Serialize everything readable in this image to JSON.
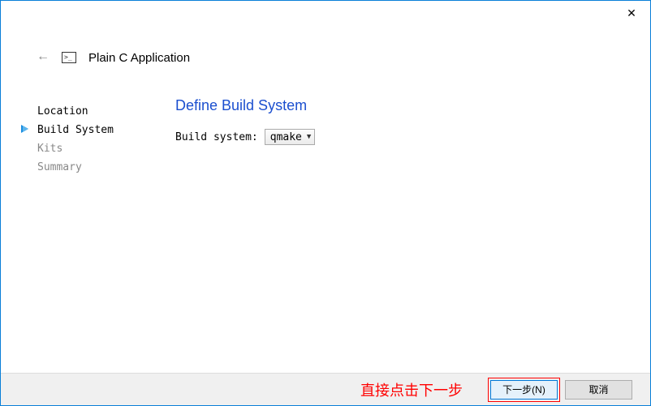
{
  "window": {
    "title": "Plain C Application"
  },
  "steps": [
    {
      "label": "Location",
      "state": "done"
    },
    {
      "label": "Build System",
      "state": "current"
    },
    {
      "label": "Kits",
      "state": "pending"
    },
    {
      "label": "Summary",
      "state": "pending"
    }
  ],
  "page": {
    "title": "Define Build System",
    "build_system_label": "Build system:",
    "build_system_value": "qmake"
  },
  "footer": {
    "annotation": "直接点击下一步",
    "next": "下一步(N)",
    "cancel": "取消"
  }
}
